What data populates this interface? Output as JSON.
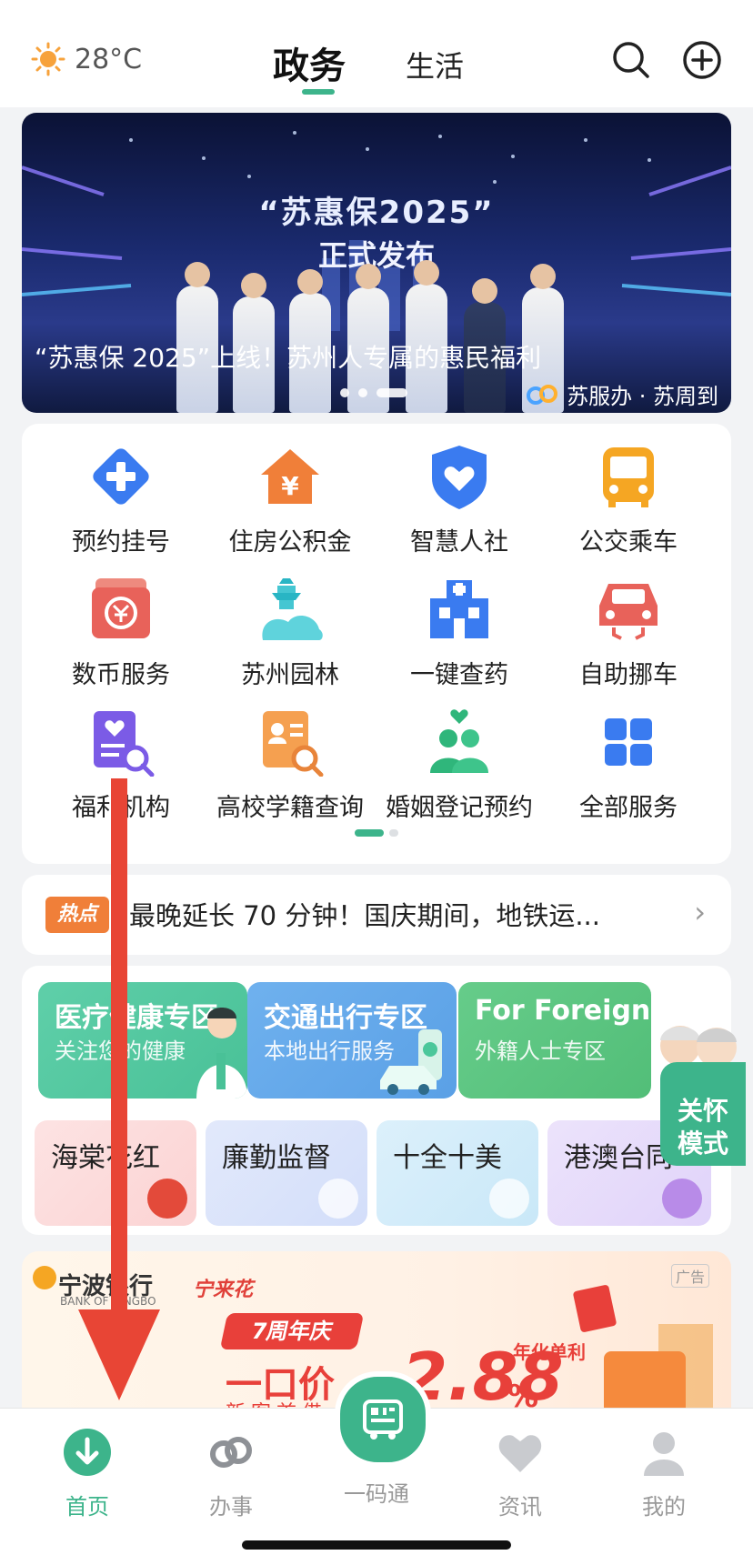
{
  "header": {
    "weather": {
      "temp": "28°C",
      "icon": "sun-icon"
    },
    "tabs": [
      {
        "label": "政务",
        "active": true
      },
      {
        "label": "生活",
        "active": false
      }
    ],
    "actions": [
      "search-icon",
      "add-circle-icon"
    ]
  },
  "banner": {
    "headline": "“苏惠保2025”",
    "subheadline": "正式发布",
    "caption": "“苏惠保 2025”上线！苏州人专属的惠民福利",
    "source": "苏服办 · 苏周到",
    "slide_count": 3,
    "active_slide": 3
  },
  "services": [
    {
      "label": "预约挂号",
      "icon": "medical-cross-icon"
    },
    {
      "label": "住房公积金",
      "icon": "house-yuan-icon"
    },
    {
      "label": "智慧人社",
      "icon": "shield-heart-icon"
    },
    {
      "label": "公交乘车",
      "icon": "bus-icon"
    },
    {
      "label": "数币服务",
      "icon": "digital-currency-icon"
    },
    {
      "label": "苏州园林",
      "icon": "pagoda-icon"
    },
    {
      "label": "一键查药",
      "icon": "hospital-icon"
    },
    {
      "label": "自助挪车",
      "icon": "car-icon"
    },
    {
      "label": "福利机构",
      "icon": "heart-document-icon"
    },
    {
      "label": "高校学籍查询",
      "icon": "student-card-search-icon"
    },
    {
      "label": "婚姻登记预约",
      "icon": "couple-heart-icon"
    },
    {
      "label": "全部服务",
      "icon": "grid-icon"
    }
  ],
  "services_page": {
    "current": 1,
    "total": 2
  },
  "hot": {
    "tag": "热点",
    "text": "最晚延长 70 分钟！国庆期间，地铁运..."
  },
  "zones": {
    "big": [
      {
        "title": "医疗健康专区",
        "subtitle": "关注您的健康",
        "color": "#5fcfa9"
      },
      {
        "title": "交通出行专区",
        "subtitle": "本地出行服务",
        "color": "#6fb1ee"
      },
      {
        "title": "For Foreigners",
        "subtitle": "外籍人士专区",
        "color": "#66cc8a"
      }
    ],
    "small": [
      {
        "title": "海棠花红",
        "color": "#fde3e3"
      },
      {
        "title": "廉勤监督",
        "color": "#e2e9fb"
      },
      {
        "title": "十全十美",
        "color": "#dcf0fb"
      },
      {
        "title": "港澳台同",
        "color": "#ece3fb"
      }
    ]
  },
  "care_mode": {
    "label_line1": "关怀",
    "label_line2": "模式"
  },
  "ad": {
    "bank": "宁波银行",
    "bank_en": "BANK OF NINGBO",
    "product": "宁来花",
    "ribbon": "7周年庆",
    "line": "一口价",
    "rate": "2.88",
    "rate_unit": "年化单利",
    "percent": "%",
    "sub": "新客首借",
    "badge": "广告"
  },
  "nav": [
    {
      "label": "首页",
      "icon": "download-circle-icon",
      "active": true
    },
    {
      "label": "办事",
      "icon": "logo-knot-icon",
      "active": false
    },
    {
      "label": "一码通",
      "icon": "qr-bus-icon",
      "active": false
    },
    {
      "label": "资讯",
      "icon": "heart-icon",
      "active": false
    },
    {
      "label": "我的",
      "icon": "user-icon",
      "active": false
    }
  ],
  "colors": {
    "accent": "#3db48b",
    "annotation": "#e84535"
  }
}
